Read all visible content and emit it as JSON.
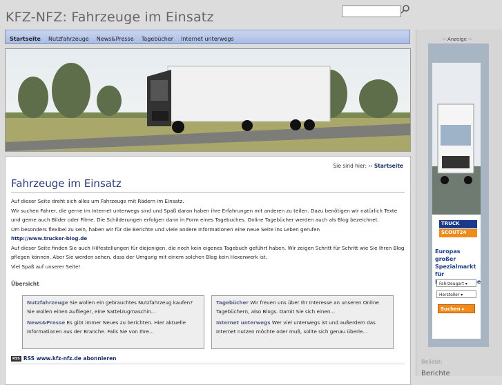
{
  "header": {
    "site_title": "KFZ-NFZ: Fahrzeuge im Einsatz",
    "search_placeholder": ""
  },
  "nav": {
    "items": [
      {
        "label": "Startseite",
        "active": true
      },
      {
        "label": "Nutzfahrzeuge",
        "active": false
      },
      {
        "label": "News&Presse",
        "active": false
      },
      {
        "label": "Tagebücher",
        "active": false
      },
      {
        "label": "Internet unterwegs",
        "active": false
      }
    ]
  },
  "breadcrumb": {
    "prefix": "Sie sind hier:",
    "current": "Startseite"
  },
  "main": {
    "title": "Fahrzeuge im Einsatz",
    "paragraphs": [
      "Auf dieser Seite dreht sich alles um Fahrzeuge mit Rädern im Einsatz.",
      "Wir suchen Fahrer, die gerne im Internet unterwegs sind und Spaß daran haben ihre Erfahrungen mit anderen zu teilen. Dazu benötigen wir natürlich Texte und gerne auch Bilder oder Filme. Die Schilderungen erfolgen dann in Form eines Tagebuches. Online Tagebücher werden auch als Blog bezeichnet.",
      "Um besonders flexibel zu sein, haben wir für die Berichte und viele andere Informationen eine neue Seite ins Leben gerufen"
    ],
    "link": "http://www.trucker-blog.de",
    "paragraphs2": [
      "Auf dieser Seite finden Sie auch Hilfestellungen für diejenigen, die noch kein eigenes Tagebuch geführt haben. Wir zeigen Schritt für Schritt wie Sie Ihren Blog pflegen können. Aber Sie werden sehen, dass der Umgang mit einem solchen Blog kein Hexenwerk ist.",
      "Viel Spaß auf unserer Seite!"
    ],
    "overview_heading": "Übersicht",
    "overview_left": [
      {
        "keyword": "Nutzfahrzeuge",
        "text": " Sie wollen ein gebrauchtes Nutzfahrzeug kaufen? Sie wollen einen Auflieger, eine Sattelzugmaschin..."
      },
      {
        "keyword": "News&Presse",
        "text": " Es gibt immer Neues zu berichten. Hier aktuelle Informationen aus der Branche. Falls Sie von Ihre..."
      }
    ],
    "overview_right": [
      {
        "keyword": "Tagebücher",
        "text": " Wir freuen uns über Ihr Interesse an unseren Online Tagebüchern, also Blogs. Damit Sie sich einen..."
      },
      {
        "keyword": "Internet unterwegs",
        "text": " Wer viel unterwegs ist und außerdem das Internet nutzen möchte oder muß, sollte sich genau überle..."
      }
    ],
    "rss_badge": "RSS",
    "rss_label": "RSS www.kfz-nfz.de abonnieren"
  },
  "sidebar": {
    "ad_label": "-- Anzeige --",
    "ad_logo_top": "TRUCK",
    "ad_logo_bottom": "SCOUT24",
    "ad_title": "Europas großer Spezialmarkt für Nutzfahrzeuge",
    "ad_select1": "Fahrzeugart",
    "ad_select2": "Hersteller",
    "ad_button": "Suchen",
    "popular_label": "Beliebt:",
    "berichte_label": "Berichte"
  }
}
